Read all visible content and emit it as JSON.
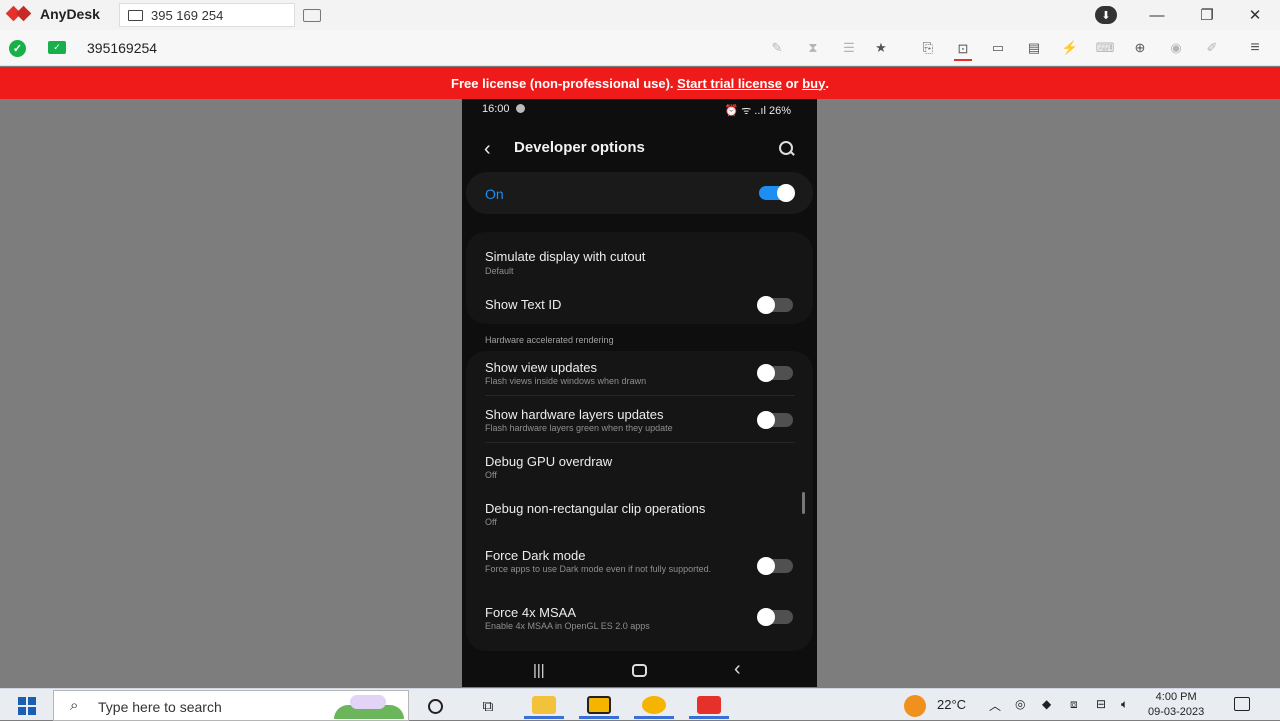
{
  "app": {
    "name": "AnyDesk",
    "tab_label": "395 169 254",
    "address": "395169254"
  },
  "window_controls": {
    "minimize": "—",
    "restore": "❐",
    "close": "✕"
  },
  "banner": {
    "prefix": "Free license (non-professional use). ",
    "trial_link": "Start trial license",
    "middle": " or ",
    "buy_link": "buy",
    "suffix": "."
  },
  "phone": {
    "status_time": "16:00",
    "status_right": "⏰ ᯤ ..ıl 26%",
    "title": "Developer options",
    "master_label": "On",
    "master_on": true,
    "section_header": "Hardware accelerated rendering",
    "items": [
      {
        "title": "Simulate display with cutout",
        "subtitle": "Default"
      },
      {
        "title": "Show Text ID",
        "toggle": false
      },
      {
        "title": "Show view updates",
        "subtitle": "Flash views inside windows when drawn",
        "toggle": false
      },
      {
        "title": "Show hardware layers updates",
        "subtitle": "Flash hardware layers green when they update",
        "toggle": false
      },
      {
        "title": "Debug GPU overdraw",
        "subtitle": "Off"
      },
      {
        "title": "Debug non-rectangular clip operations",
        "subtitle": "Off"
      },
      {
        "title": "Force Dark mode",
        "subtitle": "Force apps to use Dark mode even if not fully supported.",
        "toggle": false
      },
      {
        "title": "Force 4x MSAA",
        "subtitle": "Enable 4x MSAA in OpenGL ES 2.0 apps",
        "toggle": false
      }
    ],
    "nav": {
      "recent": "|||",
      "back": "‹"
    }
  },
  "toolbar_icons": [
    "chat-icon",
    "hourglass-icon",
    "database-icon",
    "star-icon",
    "file-transfer-icon",
    "screen-share-icon",
    "display-icon",
    "chat-bubble-icon",
    "bolt-icon",
    "keyboard-icon",
    "privacy-icon",
    "record-icon",
    "draw-icon",
    "menu-icon"
  ],
  "taskbar": {
    "search_placeholder": "Type here to search",
    "temperature": "22°C",
    "time": "4:00 PM",
    "date": "09-03-2023"
  },
  "colors": {
    "accent": "#1d8ff2",
    "banner": "#ef1b1b",
    "anydesk_red": "#e5312a",
    "ok_green": "#19b04b"
  }
}
